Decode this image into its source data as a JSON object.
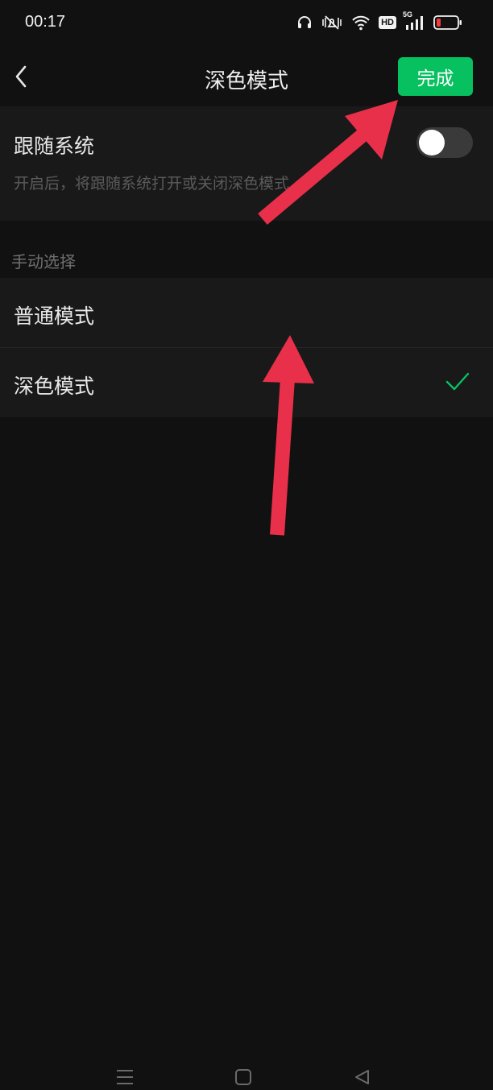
{
  "status_bar": {
    "time": "00:17",
    "hd_label": "HD",
    "network_label": "5G"
  },
  "nav": {
    "title": "深色模式",
    "done_label": "完成"
  },
  "follow_system": {
    "title": "跟随系统",
    "description": "开启后，将跟随系统打开或关闭深色模式",
    "enabled": false
  },
  "manual": {
    "section_label": "手动选择",
    "options": [
      {
        "label": "普通模式",
        "selected": false
      },
      {
        "label": "深色模式",
        "selected": true
      }
    ]
  },
  "colors": {
    "accent": "#07c160",
    "background": "#111111",
    "card": "#191919",
    "annotation_arrow": "#e8304a"
  }
}
